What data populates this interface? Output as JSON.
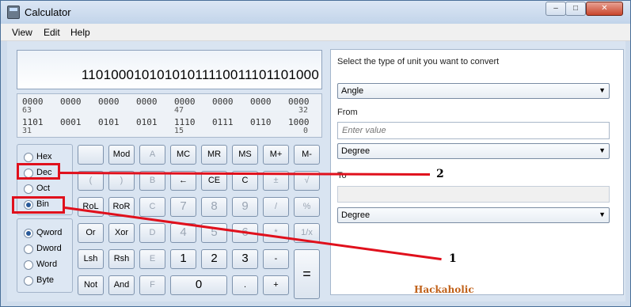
{
  "window": {
    "title": "Calculator",
    "min_glyph": "–",
    "max_glyph": "□",
    "close_glyph": "✕"
  },
  "menu": {
    "view": "View",
    "edit": "Edit",
    "help": "Help"
  },
  "display": {
    "value": "11010001010101011110011101101000"
  },
  "bits": {
    "row1": [
      "0000",
      "0000",
      "0000",
      "0000",
      "0000",
      "0000",
      "0000",
      "0000"
    ],
    "row1_labels": [
      "63",
      "",
      "",
      "",
      "47",
      "",
      "",
      "32"
    ],
    "row2": [
      "1101",
      "0001",
      "0101",
      "0101",
      "1110",
      "0111",
      "0110",
      "1000"
    ],
    "row2_labels": [
      "31",
      "",
      "",
      "",
      "15",
      "",
      "",
      "0"
    ]
  },
  "radix": [
    "Hex",
    "Dec",
    "Oct",
    "Bin"
  ],
  "radix_selected": "Bin",
  "word_size": [
    "Qword",
    "Dword",
    "Word",
    "Byte"
  ],
  "word_selected": "Qword",
  "keys": {
    "row1": [
      "",
      "Mod",
      "A",
      "MC",
      "MR",
      "MS",
      "M+",
      "M-"
    ],
    "row2": [
      "(",
      ")",
      "B",
      "←",
      "CE",
      "C",
      "±",
      "√"
    ],
    "row3": [
      "RoL",
      "RoR",
      "C",
      "7",
      "8",
      "9",
      "/",
      "%"
    ],
    "row4": [
      "Or",
      "Xor",
      "D",
      "4",
      "5",
      "6",
      "*",
      "1/x"
    ],
    "row5": [
      "Lsh",
      "Rsh",
      "E",
      "1",
      "2",
      "3",
      "-",
      "="
    ],
    "row6": [
      "Not",
      "And",
      "F",
      "0",
      ".",
      "+"
    ]
  },
  "converter": {
    "heading": "Select the type of unit you want to convert",
    "type": "Angle",
    "from_label": "From",
    "from_placeholder": "Enter value",
    "from_unit": "Degree",
    "to_label": "To",
    "to_unit": "Degree"
  },
  "annotations": {
    "callout_1": "1",
    "callout_2": "2",
    "watermark": "Hackaholic"
  },
  "colors": {
    "highlight": "#e0101c",
    "watermark": "#c06018"
  },
  "icons": {
    "app": "calculator-icon",
    "dropdown": "chevron-down-icon",
    "radio": "radio-dot-icon"
  }
}
